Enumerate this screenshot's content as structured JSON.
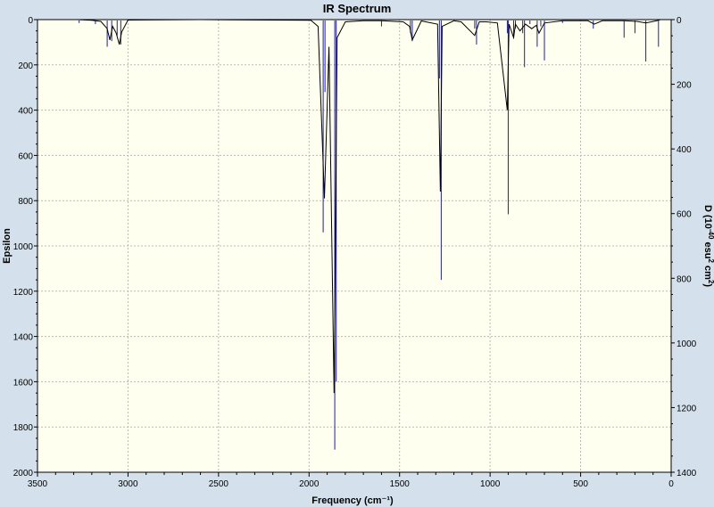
{
  "chart_data": {
    "type": "line",
    "title": "IR Spectrum",
    "xlabel": "Frequency (cm⁻¹)",
    "ylabel_left": "Epsilon",
    "ylabel_right_html": "D (10<tspan baseline-shift='super' font-size='8'>-40</tspan> esu<tspan baseline-shift='super' font-size='8'>2</tspan> cm<tspan baseline-shift='super' font-size='8'>2</tspan>)",
    "ylabel_right_parts": [
      {
        "text": "D (10",
        "sup": false
      },
      {
        "text": "-40",
        "sup": true
      },
      {
        "text": " esu",
        "sup": false
      },
      {
        "text": "2",
        "sup": true
      },
      {
        "text": " cm",
        "sup": false
      },
      {
        "text": "2",
        "sup": true
      },
      {
        "text": ")",
        "sup": false
      }
    ],
    "xlim": [
      3500,
      0
    ],
    "ylim_left": [
      0,
      2000
    ],
    "ylim_right": [
      0,
      1400
    ],
    "x_reversed": true,
    "y_inverted": true,
    "x_ticks": [
      3500,
      3000,
      2500,
      2000,
      1500,
      1000,
      500,
      0
    ],
    "y_ticks_left": [
      0,
      200,
      400,
      600,
      800,
      1000,
      1200,
      1400,
      1600,
      1800,
      2000
    ],
    "y_ticks_right": [
      0,
      200,
      400,
      600,
      800,
      1000,
      1200,
      1400
    ],
    "grid": true,
    "colors": {
      "background": "#d4e1ec",
      "plot_area": "#fffff0",
      "spectrum_line": "#000000",
      "stick_lines": "#1f1fa0",
      "grid": "#b8b8b8"
    },
    "series": [
      {
        "style": "spectrum",
        "x": [
          3280,
          3200,
          3150,
          3115,
          3100,
          3085,
          3065,
          3048,
          3035,
          3000,
          2600,
          1990,
          1950,
          1915,
          1890,
          1862,
          1855,
          1845,
          1800,
          1700,
          1600,
          1480,
          1445,
          1430,
          1380,
          1290,
          1275,
          1265,
          1200,
          1160,
          1085,
          1060,
          1020,
          960,
          905,
          895,
          870,
          860,
          835,
          805,
          770,
          745,
          730,
          700,
          600,
          460,
          425,
          380,
          260,
          190,
          140,
          80,
          60
        ],
        "y": [
          0,
          3,
          8,
          40,
          90,
          30,
          60,
          110,
          55,
          2,
          0,
          3,
          30,
          790,
          120,
          1650,
          1050,
          80,
          10,
          5,
          5,
          10,
          30,
          90,
          6,
          20,
          760,
          30,
          5,
          10,
          70,
          10,
          10,
          15,
          400,
          20,
          80,
          20,
          50,
          20,
          40,
          25,
          60,
          15,
          5,
          5,
          20,
          5,
          5,
          8,
          15,
          5,
          0
        ]
      },
      {
        "style": "sticks",
        "x": [
          3270,
          3180,
          3115,
          3090,
          3060,
          3040,
          1922,
          1912,
          1858,
          1850,
          1600,
          1440,
          1430,
          1280,
          1270,
          1085,
          1075,
          905,
          900,
          870,
          860,
          820,
          810,
          780,
          740,
          720,
          700,
          600,
          430,
          260,
          200,
          140,
          70
        ],
        "y": [
          15,
          20,
          120,
          95,
          70,
          110,
          940,
          320,
          1900,
          1600,
          30,
          60,
          95,
          260,
          1150,
          40,
          110,
          60,
          860,
          85,
          40,
          60,
          210,
          20,
          120,
          30,
          180,
          15,
          40,
          80,
          60,
          185,
          120
        ]
      }
    ]
  }
}
